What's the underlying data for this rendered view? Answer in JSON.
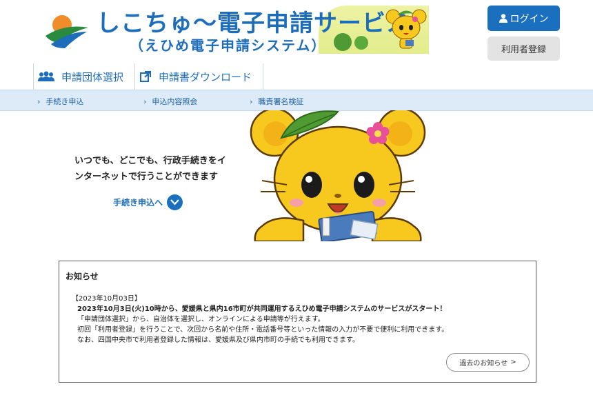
{
  "header": {
    "banner_line1": "しこちゅ〜電子申請サービス",
    "banner_line2": "（えひめ電子申請システム）",
    "login_label": "ログイン",
    "register_label": "利用者登録"
  },
  "main_nav": [
    {
      "label": "申請団体選択",
      "icon": "group-icon"
    },
    {
      "label": "申請書ダウンロード",
      "icon": "download-icon"
    }
  ],
  "sub_nav": [
    {
      "label": "手続き申込"
    },
    {
      "label": "申込内容照会"
    },
    {
      "label": "職責署名検証"
    }
  ],
  "hero": {
    "tagline": "いつでも、どこでも、行政手続きをインターネットで行うことができます",
    "link_label": "手続き申込へ"
  },
  "news": {
    "title": "お知らせ",
    "date": "【2023年10月03日】",
    "headline": "2023年10月3日(火)10時から、愛媛県と県内16市町が共同運用するえひめ電子申請システムのサービスがスタート！",
    "lines": [
      "「申請団体選択」から、自治体を選択し、オンラインによる申請等が行えます。",
      "初回「利用者登録」を行うことで、次回から名前や住所・電話番号等といった情報の入力が不要で便利に利用できます。",
      "なお、四国中央市で利用者登録した情報は、愛媛県及び県内市町の手続でも利用できます。"
    ],
    "more_label": "過去のお知らせ"
  },
  "colors": {
    "primary": "#1a6fbf",
    "subnav_bg": "#dcebf7",
    "mascot_yellow": "#f7c81e",
    "leaf_green": "#4f9a33"
  }
}
